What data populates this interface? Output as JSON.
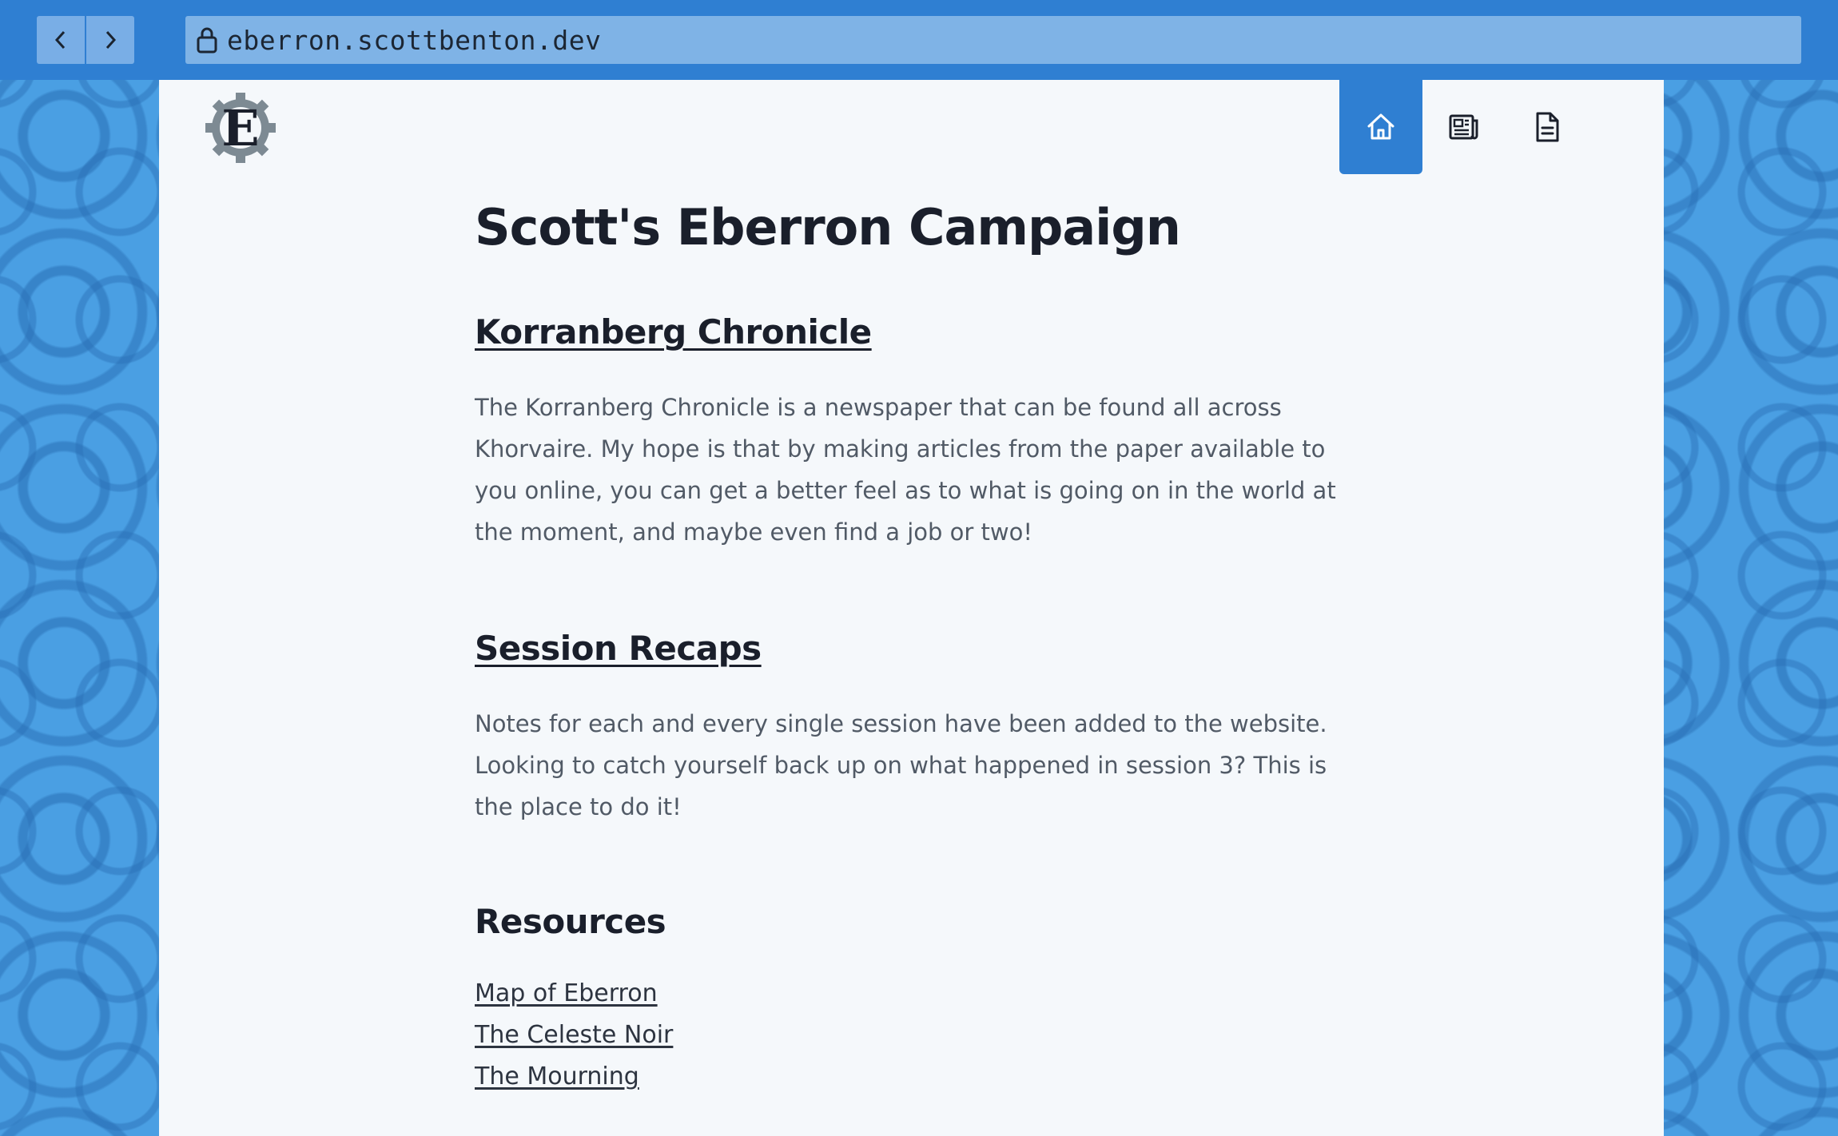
{
  "browser": {
    "url": "eberron.scottbenton.dev",
    "back_label": "‹",
    "forward_label": "›"
  },
  "site": {
    "logo_letter": "E",
    "nav": [
      {
        "icon": "home-icon",
        "active": true
      },
      {
        "icon": "newspaper-icon",
        "active": false
      },
      {
        "icon": "document-icon",
        "active": false
      }
    ]
  },
  "main": {
    "title": "Scott's Eberron Campaign",
    "sections": [
      {
        "heading": "Korranberg Chronicle",
        "body": "The Korranberg Chronicle is a newspaper that can be found all across Khorvaire. My hope is that by making articles from the paper available to you online, you can get a better feel as to what is going on in the world at the moment, and maybe even find a job or two!"
      },
      {
        "heading": "Session Recaps",
        "body": "Notes for each and every single session have been added to the website. Looking to catch yourself back up on what happened in session 3? This is the place to do it!"
      }
    ],
    "resources": {
      "heading": "Resources",
      "links": [
        "Map of Eberron",
        "The Celeste Noir",
        "The Mourning"
      ]
    }
  },
  "colors": {
    "accent": "#2f7fd2",
    "background": "#4a9fe3",
    "page": "#f5f8fb",
    "text": "#1a1f2b",
    "body_text": "#515a66"
  }
}
